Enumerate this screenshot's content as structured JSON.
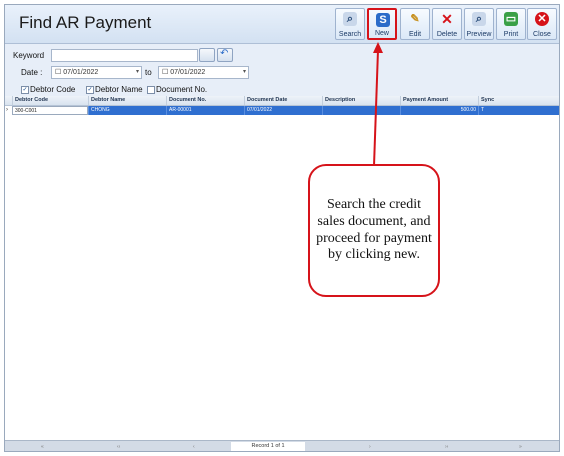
{
  "window": {
    "title": "Find AR Payment"
  },
  "toolbar": {
    "buttons": [
      {
        "key": "search",
        "label": "Search",
        "icon": "magnifier-icon",
        "color": "#9fb3cf"
      },
      {
        "key": "new",
        "label": "New",
        "icon": "new-document-icon",
        "color": "#2b6cc9"
      },
      {
        "key": "edit",
        "label": "Edit",
        "icon": "pencil-icon",
        "color": "#c7901f"
      },
      {
        "key": "delete",
        "label": "Delete",
        "icon": "red-x-icon",
        "color": "#d6131a"
      },
      {
        "key": "preview",
        "label": "Preview",
        "icon": "preview-icon",
        "color": "#9fb3cf"
      },
      {
        "key": "print",
        "label": "Print",
        "icon": "printer-icon",
        "color": "#3aa047"
      },
      {
        "key": "close",
        "label": "Close",
        "icon": "close-icon",
        "color": "#d6131a"
      }
    ]
  },
  "filters": {
    "keyword_label": "Keyword",
    "keyword_value": "",
    "date_label": "Date :",
    "date_from": "07/01/2022",
    "to_label": "to",
    "date_to": "07/01/2022",
    "checkboxes": [
      {
        "label": "Debtor Code",
        "checked": true
      },
      {
        "label": "Debtor Name",
        "checked": true
      },
      {
        "label": "Document No.",
        "checked": false
      }
    ]
  },
  "grid": {
    "columns": [
      "Debtor Code",
      "Debtor Name",
      "Document No.",
      "Document Date",
      "Description",
      "Payment Amount",
      "Sync"
    ],
    "rows": [
      [
        "300-C001",
        "CHONG",
        "AR-00001",
        "07/01/2022",
        "",
        "500.00",
        "T"
      ]
    ]
  },
  "footer": {
    "record_text": "Record 1 of 1"
  },
  "callout": {
    "text": "Search the credit sales document, and proceed for payment by clicking new.",
    "color": "#d6131a"
  }
}
